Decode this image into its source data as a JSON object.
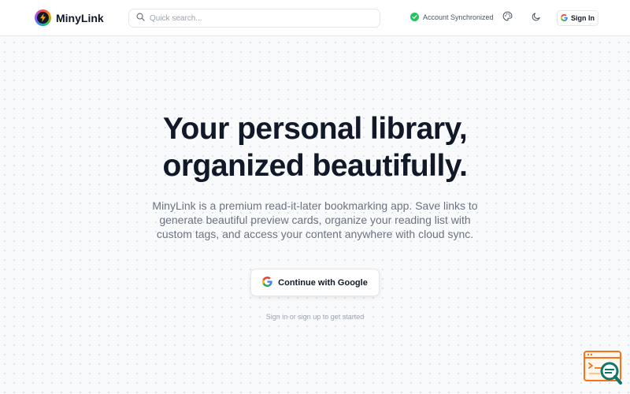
{
  "header": {
    "app_name": "MinyLink",
    "search_placeholder": "Quick search...",
    "sync_status": "Account Synchronized",
    "sign_in_label": "Sign In"
  },
  "hero": {
    "title_line1": "Your personal library,",
    "title_line2": "organized beautifully.",
    "description": "MinyLink is a premium read-it-later bookmarking app. Save links to generate beautiful preview cards, organize your reading list with custom tags, and access your content anywhere with cloud sync.",
    "cta_label": "Continue with Google",
    "hint": "Sign in or sign up to get started"
  },
  "colors": {
    "accent_green": "#22c55e",
    "widget_orange": "#f97316",
    "widget_teal": "#0f766e"
  },
  "icons": [
    "logo-icon",
    "search-icon",
    "check-icon",
    "palette-icon",
    "moon-icon",
    "google-icon",
    "feedback-widget-icon"
  ]
}
